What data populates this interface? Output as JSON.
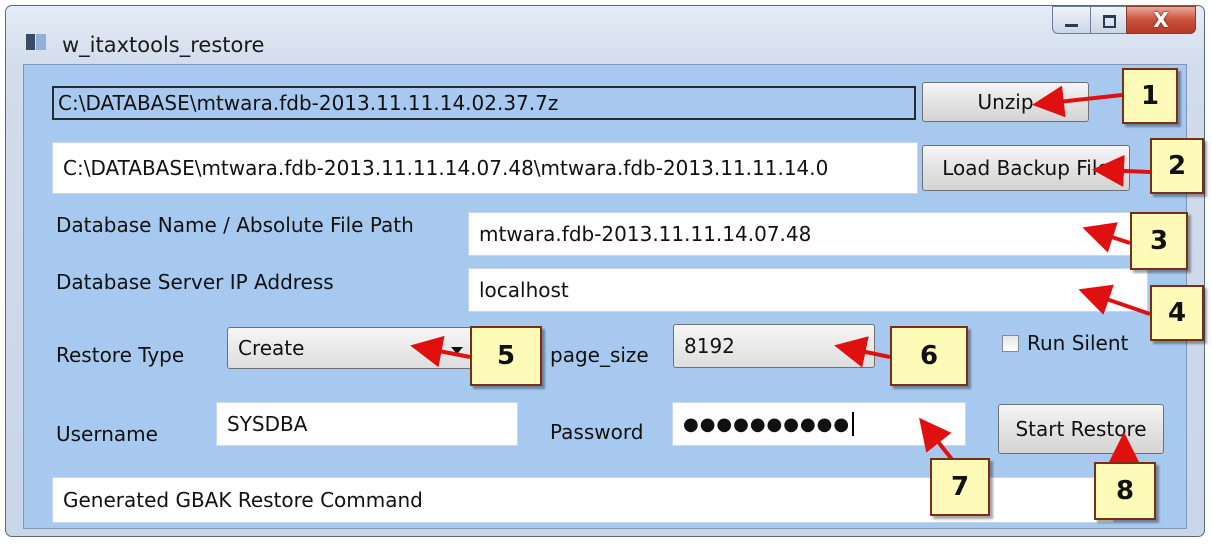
{
  "window": {
    "title": "w_itaxtools_restore",
    "close_glyph": "X"
  },
  "form": {
    "zip_path": "C:\\DATABASE\\mtwara.fdb-2013.11.11.14.02.37.7z",
    "unzip_label": "Unzip",
    "backup_path": "C:\\DATABASE\\mtwara.fdb-2013.11.11.14.07.48\\mtwara.fdb-2013.11.11.14.0",
    "load_backup_label": "Load Backup File",
    "db_name_label": "Database Name / Absolute File Path",
    "db_name_value": "mtwara.fdb-2013.11.11.14.07.48",
    "server_ip_label": "Database Server IP Address",
    "server_ip_value": "localhost",
    "restore_type_label": "Restore Type",
    "restore_type_value": "Create",
    "page_size_label": "page_size",
    "page_size_value": "8192",
    "run_silent_label": "Run Silent",
    "username_label": "Username",
    "username_value": "SYSDBA",
    "password_label": "Password",
    "password_mask": "●●●●●●●●●●",
    "start_restore_label": "Start Restore",
    "gbak_command_value": "Generated GBAK Restore Command"
  },
  "callouts": [
    "1",
    "2",
    "3",
    "4",
    "5",
    "6",
    "7",
    "8"
  ],
  "colors": {
    "client_bg": "#a8c9ef",
    "callout_bg": "#fdfbb7",
    "callout_border": "#7a2f14",
    "arrow_red": "#e01010"
  }
}
